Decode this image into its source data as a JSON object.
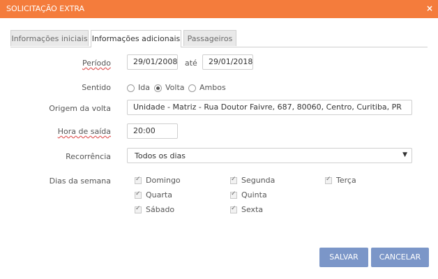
{
  "dialog": {
    "title": "SOLICITAÇÃO EXTRA",
    "close_icon": "×"
  },
  "tabs": [
    {
      "label": "Informações iniciais",
      "active": false
    },
    {
      "label": "Informações adicionais",
      "active": true
    },
    {
      "label": "Passageiros",
      "active": false
    }
  ],
  "form": {
    "periodo": {
      "label": "Período",
      "start": "29/01/2008",
      "separator": "até",
      "end": "29/01/2018"
    },
    "sentido": {
      "label": "Sentido",
      "options": [
        "Ida",
        "Volta",
        "Ambos"
      ],
      "selected": "Volta"
    },
    "origem": {
      "label": "Origem da volta",
      "value": "Unidade - Matriz - Rua Doutor Faivre, 687, 80060, Centro, Curitiba, PR"
    },
    "hora": {
      "label": "Hora de saída",
      "value": "20:00"
    },
    "recorrencia": {
      "label": "Recorrência",
      "value": "Todos os dias"
    },
    "dias": {
      "label": "Dias da semana",
      "items": [
        {
          "label": "Domingo",
          "checked": true
        },
        {
          "label": "Segunda",
          "checked": true
        },
        {
          "label": "Terça",
          "checked": true
        },
        {
          "label": "Quarta",
          "checked": true
        },
        {
          "label": "Quinta",
          "checked": true
        },
        {
          "label": "Sábado",
          "checked": true
        },
        {
          "label": "Sexta",
          "checked": true
        }
      ]
    }
  },
  "buttons": {
    "save": "SALVAR",
    "cancel": "CANCELAR"
  },
  "colors": {
    "header": "#f47c3c",
    "button": "#7b96c8"
  }
}
